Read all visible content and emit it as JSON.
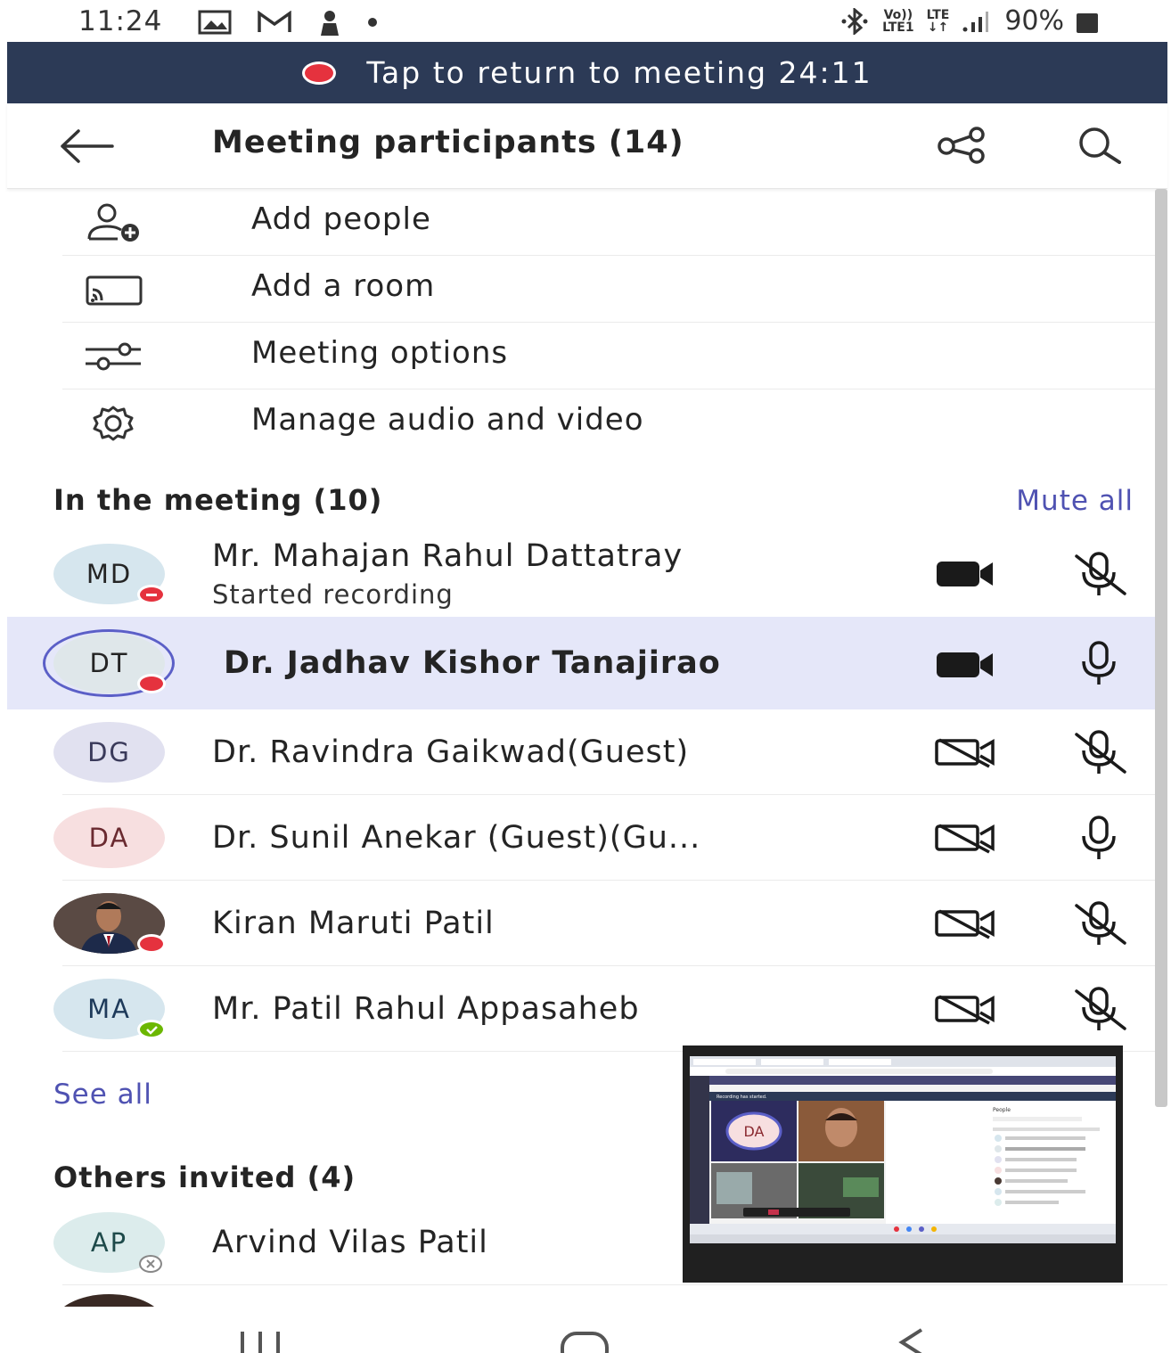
{
  "status_bar": {
    "time": "11:24",
    "signal_volte_top": "Vo))",
    "signal_volte_bottom": "LTE1",
    "signal_lte_top": "LTE",
    "signal_lte_bottom": "↓↑",
    "battery": "90%"
  },
  "banner": {
    "text": "Tap to return to meeting 24:11"
  },
  "header": {
    "title": "Meeting participants (14)"
  },
  "actions": [
    {
      "label": "Add people",
      "icon": "add-person-icon"
    },
    {
      "label": "Add a room",
      "icon": "cast-icon"
    },
    {
      "label": "Meeting options",
      "icon": "sliders-icon"
    },
    {
      "label": "Manage audio and video",
      "icon": "gear-icon"
    }
  ],
  "in_meeting": {
    "title": "In the meeting (10)",
    "mute_all": "Mute all",
    "participants": [
      {
        "initials": "MD",
        "name": "Mr. Mahajan Rahul Dattatray",
        "subtitle": "Started recording",
        "camera": "on",
        "mic": "muted",
        "presence": "busy",
        "avatar_bg": "#d6e6ee"
      },
      {
        "initials": "DT",
        "name": "Dr. Jadhav Kishor Tanajirao",
        "subtitle": "",
        "camera": "on",
        "mic": "on",
        "presence": "busy",
        "avatar_bg": "#dfe7ea",
        "speaking": true
      },
      {
        "initials": "DG",
        "name": "Dr. Ravindra Gaikwad(Guest)",
        "subtitle": "",
        "camera": "off",
        "mic": "muted",
        "presence": "",
        "avatar_bg": "#e1e1f0"
      },
      {
        "initials": "DA",
        "name": "Dr. Sunil Anekar (Guest)(Gu...",
        "subtitle": "",
        "camera": "off",
        "mic": "on",
        "presence": "",
        "avatar_bg": "#f7dfe0"
      },
      {
        "initials": "",
        "name": "Kiran Maruti Patil",
        "subtitle": "",
        "camera": "off",
        "mic": "muted",
        "presence": "busy",
        "avatar_bg": "#4a3a34",
        "photo": true
      },
      {
        "initials": "MA",
        "name": "Mr. Patil Rahul Appasaheb",
        "subtitle": "",
        "camera": "off",
        "mic": "muted",
        "presence": "available",
        "avatar_bg": "#d6e6ee"
      }
    ],
    "see_all": "See all"
  },
  "others_invited": {
    "title": "Others invited (4)",
    "participants": [
      {
        "initials": "AP",
        "name": "Arvind Vilas Patil",
        "presence": "declined",
        "avatar_bg": "#dcecec"
      }
    ]
  },
  "pip": {
    "tile_initials": "DA",
    "panel_title": "People",
    "recording_notice": "Recording has started."
  },
  "colors": {
    "banner_bg": "#2c3a56",
    "accent": "#4f52b2",
    "highlight_row": "#e5e7f9",
    "busy": "#e5323e",
    "available": "#6bb700"
  }
}
